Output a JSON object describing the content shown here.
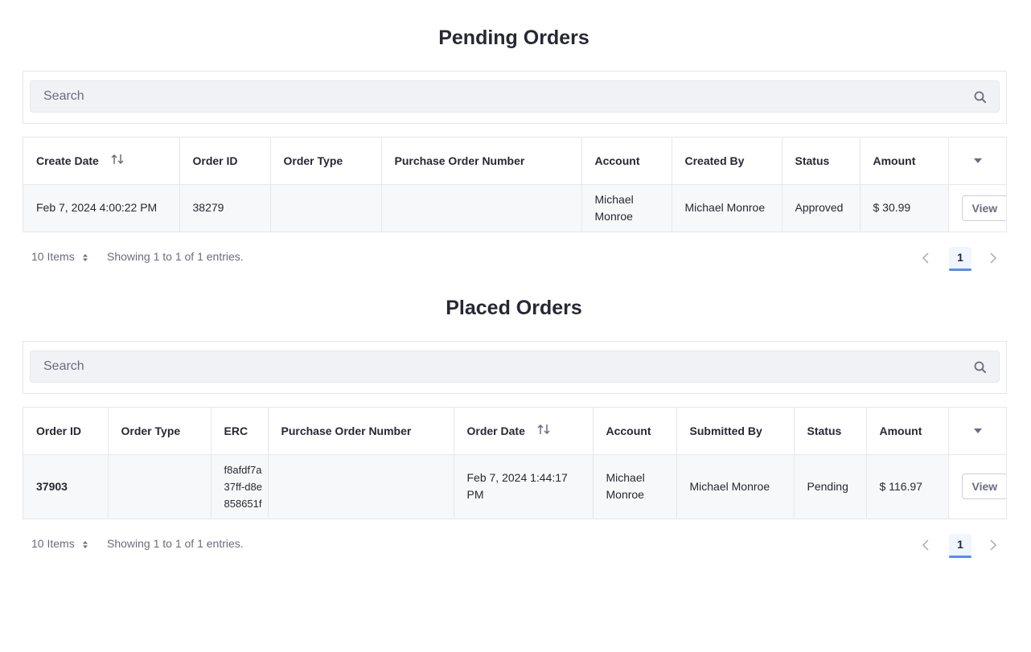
{
  "pending": {
    "title": "Pending Orders",
    "search_placeholder": "Search",
    "columns": [
      "Create Date",
      "Order ID",
      "Order Type",
      "Purchase Order Number",
      "Account",
      "Created By",
      "Status",
      "Amount"
    ],
    "rows": [
      {
        "create_date": "Feb 7, 2024 4:00:22 PM",
        "order_id": "38279",
        "order_type": "",
        "po_number": "",
        "account_line1": "Michael",
        "account_line2": "Monroe",
        "created_by": "Michael Monroe",
        "status": "Approved",
        "amount": "$ 30.99",
        "action": "View"
      }
    ],
    "footer": {
      "items_per_page": "10 Items",
      "entries_text": "Showing 1 to 1 of 1 entries.",
      "current_page": "1"
    }
  },
  "placed": {
    "title": "Placed Orders",
    "search_placeholder": "Search",
    "columns": [
      "Order ID",
      "Order Type",
      "ERC",
      "Purchase Order Number",
      "Order Date",
      "Account",
      "Submitted By",
      "Status",
      "Amount"
    ],
    "rows": [
      {
        "order_id": "37903",
        "order_type": "",
        "erc_line1": "f8afdf7a",
        "erc_line2": "37ff-d8e",
        "erc_line3": "858651f",
        "po_number": "",
        "order_date_line1": "Feb 7, 2024 1:44:17",
        "order_date_line2": "PM",
        "account_line1": "Michael",
        "account_line2": "Monroe",
        "submitted_by": "Michael Monroe",
        "status": "Pending",
        "amount": "$ 116.97",
        "action": "View"
      }
    ],
    "footer": {
      "items_per_page": "10 Items",
      "entries_text": "Showing 1 to 1 of 1 entries.",
      "current_page": "1"
    }
  },
  "icons": {
    "search": "search-icon",
    "sort": "sort-arrows-icon",
    "caret": "caret-down-icon",
    "prev": "chevron-left-icon",
    "next": "chevron-right-icon"
  },
  "colors": {
    "accent": "#528cf6",
    "text": "#272833",
    "muted": "#6b6c7e",
    "border": "#e7e7ed",
    "row_bg": "#f7f8f9"
  }
}
